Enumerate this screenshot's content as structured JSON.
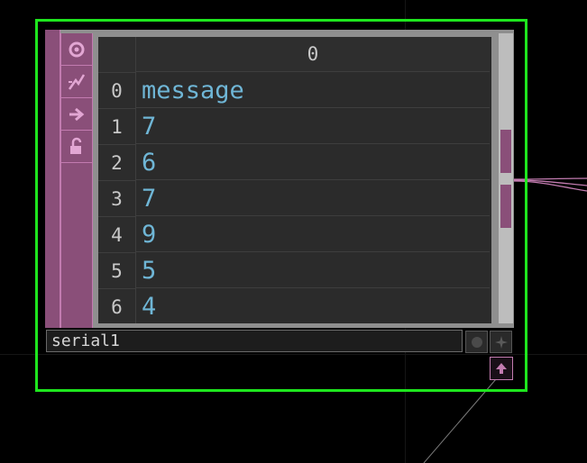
{
  "node": {
    "name": "serial1",
    "type": "DAT table",
    "colors": {
      "selection_border": "#1ee61e",
      "strip": "#8a4f79",
      "cell_text": "#6fb6d6",
      "index_text": "#c8c8c8"
    }
  },
  "table": {
    "column_header": "0",
    "rows": [
      {
        "index": "0",
        "value": "message"
      },
      {
        "index": "1",
        "value": "7"
      },
      {
        "index": "2",
        "value": "6"
      },
      {
        "index": "3",
        "value": "7"
      },
      {
        "index": "4",
        "value": "9"
      },
      {
        "index": "5",
        "value": "5"
      },
      {
        "index": "6",
        "value": "4"
      }
    ]
  },
  "side_icons": [
    "viewer-active-icon",
    "bypass-icon",
    "export-icon",
    "lock-icon"
  ],
  "flags": [
    "display-flag-icon",
    "render-flag-icon"
  ]
}
